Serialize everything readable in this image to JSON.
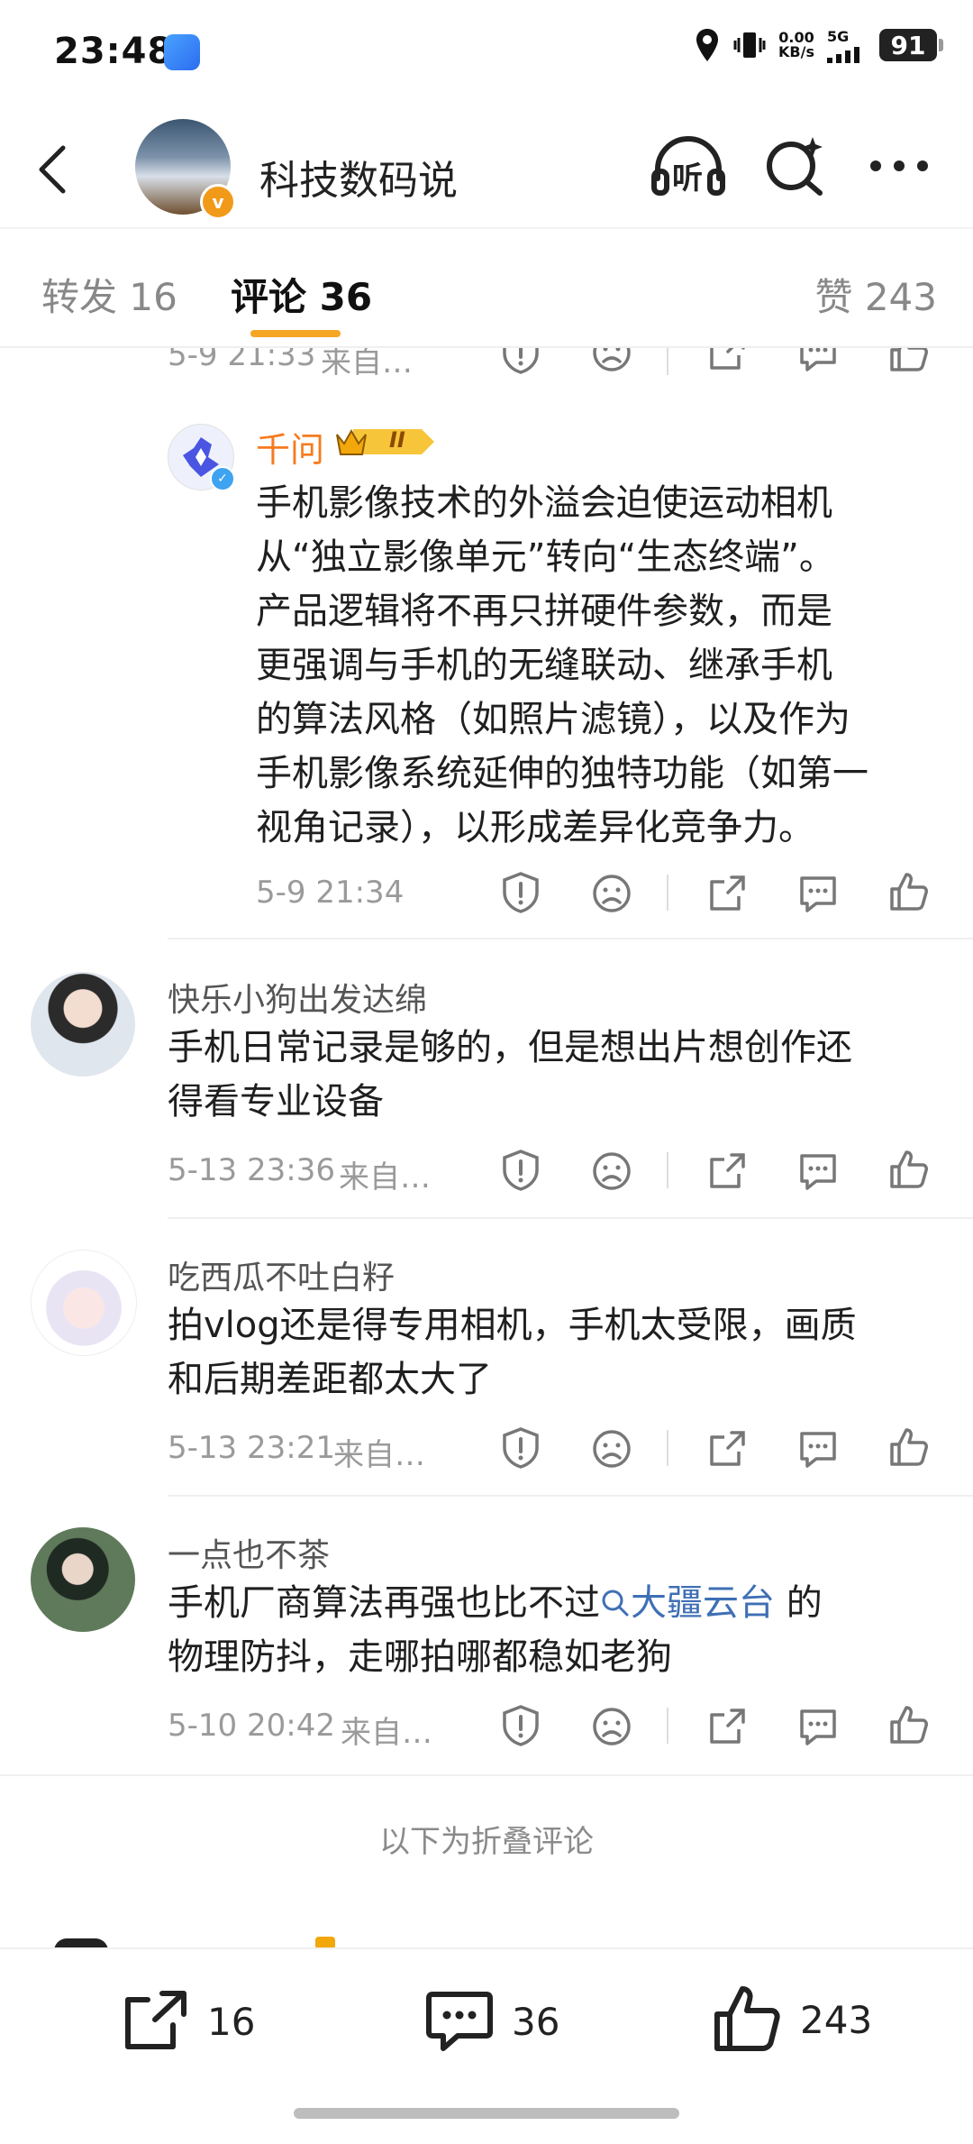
{
  "status_bar": {
    "time": "23:48",
    "net_speed_value": "0.00",
    "net_speed_unit": "KB/s",
    "network": "5G",
    "battery": "91"
  },
  "header": {
    "title": "科技数码说",
    "listen_label": "听"
  },
  "tabs": {
    "repost": "转发 16",
    "comments": "评论 36",
    "likes": "赞 243"
  },
  "top_partial_comment": {
    "time": "5-9 21:33",
    "source": "来自…"
  },
  "reply": {
    "name": "千问",
    "level": "II",
    "lines": [
      "手机影像技术的外溢会迫使运动相机",
      "从“独立影像单元”转向“生态终端”。",
      "产品逻辑将不再只拼硬件参数，而是",
      "更强调与手机的无缝联动、继承手机",
      "的算法风格（如照片滤镜），以及作为",
      "手机影像系统延伸的独特功能（如第一",
      "视角记录），以形成差异化竞争力。"
    ],
    "time": "5-9 21:34"
  },
  "comments": [
    {
      "name": "快乐小狗出发达绵",
      "lines": [
        "手机日常记录是够的，但是想出片想创作还",
        "得看专业设备"
      ],
      "time": "5-13 23:36",
      "source": "来自…"
    },
    {
      "name": "吃西瓜不吐白籽",
      "lines": [
        "拍vlog还是得专用相机，手机太受限，画质",
        "和后期差距都太大了"
      ],
      "time": "5-13 23:21",
      "source": "来自…"
    },
    {
      "name": "一点也不茶",
      "line1_pre": "手机厂商算法再强也比不过",
      "line1_topic": "大疆云台",
      "line1_post": " 的",
      "line2": "物理防抖，走哪拍哪都稳如老狗",
      "time": "5-10 20:42",
      "source": "来自…"
    }
  ],
  "fold_label": "以下为折叠评论",
  "bottom_bar": {
    "repost_count": "16",
    "comment_count": "36",
    "like_count": "243"
  }
}
